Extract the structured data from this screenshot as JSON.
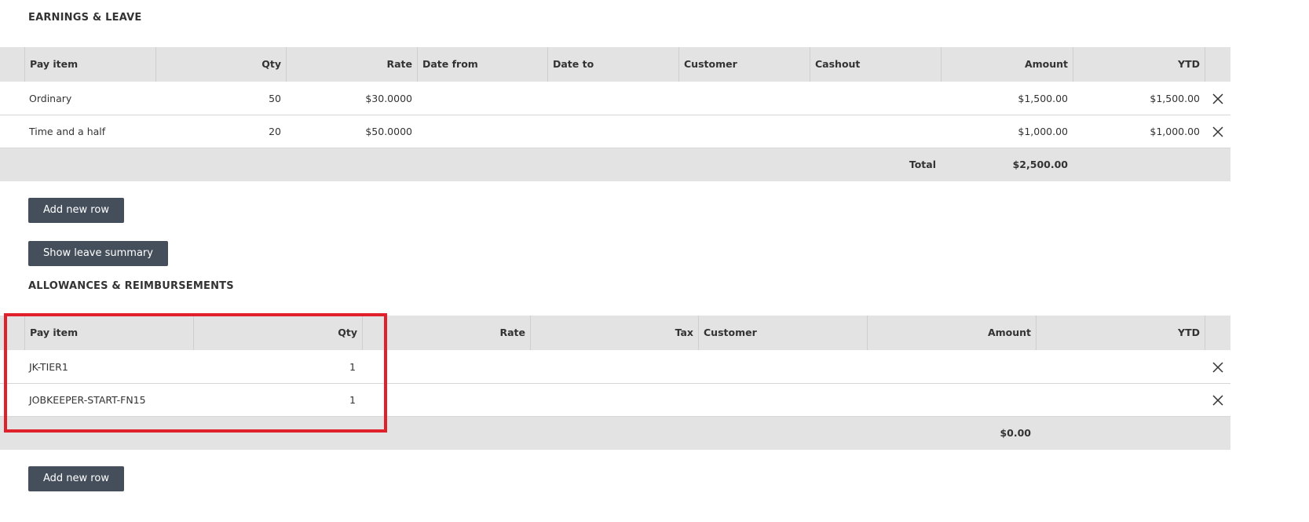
{
  "earnings": {
    "title": "EARNINGS & LEAVE",
    "columns": {
      "pay_item": "Pay item",
      "qty": "Qty",
      "rate": "Rate",
      "date_from": "Date from",
      "date_to": "Date to",
      "customer": "Customer",
      "cashout": "Cashout",
      "amount": "Amount",
      "ytd": "YTD"
    },
    "rows": [
      {
        "pay_item": "Ordinary",
        "qty": "50",
        "rate": "$30.0000",
        "amount": "$1,500.00",
        "ytd": "$1,500.00"
      },
      {
        "pay_item": "Time and a half",
        "qty": "20",
        "rate": "$50.0000",
        "amount": "$1,000.00",
        "ytd": "$1,000.00"
      }
    ],
    "total_label": "Total",
    "total_amount": "$2,500.00",
    "add_row_label": "Add new row",
    "leave_summary_label": "Show leave summary"
  },
  "allowances": {
    "title": "ALLOWANCES & REIMBURSEMENTS",
    "columns": {
      "pay_item": "Pay item",
      "qty": "Qty",
      "rate": "Rate",
      "tax": "Tax",
      "customer": "Customer",
      "amount": "Amount",
      "ytd": "YTD"
    },
    "rows": [
      {
        "pay_item": "JK-TIER1",
        "qty": "1"
      },
      {
        "pay_item": "JOBKEEPER-START-FN15",
        "qty": "1"
      }
    ],
    "total_amount": "$0.00",
    "add_row_label": "Add new row"
  },
  "icons": {
    "delete": "close-icon"
  },
  "colors": {
    "header_bg": "#e3e3e3",
    "button_bg": "#454f5b",
    "highlight": "#e0202a"
  }
}
